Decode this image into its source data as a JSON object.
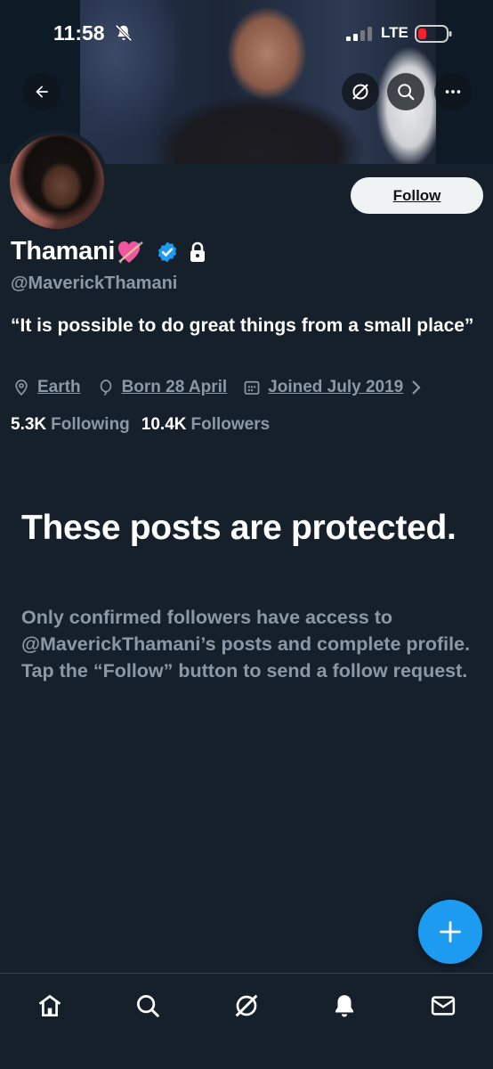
{
  "status_bar": {
    "time": "11:58",
    "network": "LTE"
  },
  "icons": {
    "back": "back-arrow-icon",
    "grok": "grok-icon",
    "search": "search-icon",
    "more": "more-icon",
    "verified": "verified-badge-icon",
    "lock": "lock-icon",
    "location": "location-icon",
    "birthday": "balloon-icon",
    "calendar": "calendar-icon",
    "compose": "plus-icon"
  },
  "profile": {
    "display_name": "Thamani",
    "handle": "@MaverickThamani",
    "bio": "“It is possible to do great things from a small place”",
    "location": "Earth",
    "birthday": "Born 28 April",
    "joined": "Joined July 2019",
    "following_count": "5.3K",
    "following_label": "Following",
    "followers_count": "10.4K",
    "followers_label": "Followers"
  },
  "follow_button": {
    "label": "Follow"
  },
  "protected": {
    "title": "These posts are protected.",
    "body": "Only confirmed followers have access to @MaverickThamani’s posts and complete profile. Tap the “Follow” button to send a follow request."
  },
  "bottom_nav": {
    "items": [
      "home",
      "search",
      "grok",
      "notifications",
      "messages"
    ]
  },
  "colors": {
    "background": "#15202b",
    "accent": "#1d9bf0",
    "secondary_text": "#8b98a5",
    "battery_low": "#f4212e"
  }
}
